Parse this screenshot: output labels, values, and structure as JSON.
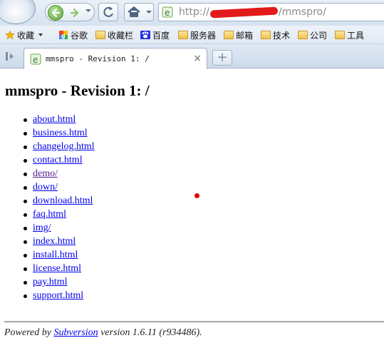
{
  "browser": {
    "address": {
      "prefix": "http://",
      "suffix": "/mmspro/"
    },
    "bookmarks": [
      {
        "label": "收藏",
        "icon": "star-icon"
      },
      {
        "label": "谷歌",
        "icon": "google-icon"
      },
      {
        "label": "收藏栏",
        "icon": "folder-icon"
      },
      {
        "label": "百度",
        "icon": "baidu-paw-icon"
      },
      {
        "label": "服务器",
        "icon": "folder-icon"
      },
      {
        "label": "邮箱",
        "icon": "folder-icon"
      },
      {
        "label": "技术",
        "icon": "folder-icon"
      },
      {
        "label": "公司",
        "icon": "folder-icon"
      },
      {
        "label": "工具",
        "icon": "folder-icon"
      }
    ],
    "tab": {
      "title": "mmspro - Revision 1: /",
      "close_glyph": "×"
    },
    "new_tab_glyph": "+"
  },
  "page": {
    "title": "mmspro - Revision 1: /",
    "entries": [
      {
        "name": "about.html",
        "visited": false
      },
      {
        "name": "business.html",
        "visited": false
      },
      {
        "name": "changelog.html",
        "visited": false
      },
      {
        "name": "contact.html",
        "visited": false
      },
      {
        "name": "demo/",
        "visited": true
      },
      {
        "name": "down/",
        "visited": false
      },
      {
        "name": "download.html",
        "visited": false
      },
      {
        "name": "faq.html",
        "visited": false
      },
      {
        "name": "img/",
        "visited": false
      },
      {
        "name": "index.html",
        "visited": false
      },
      {
        "name": "install.html",
        "visited": false
      },
      {
        "name": "license.html",
        "visited": false
      },
      {
        "name": "pay.html",
        "visited": false
      },
      {
        "name": "support.html",
        "visited": false
      }
    ],
    "footer": {
      "prefix": "Powered by ",
      "link": "Subversion",
      "suffix": " version 1.6.11 (r934486)."
    }
  },
  "colors": {
    "link": "#0000ee",
    "visited_link": "#551a8b",
    "marker": "#e00000"
  }
}
